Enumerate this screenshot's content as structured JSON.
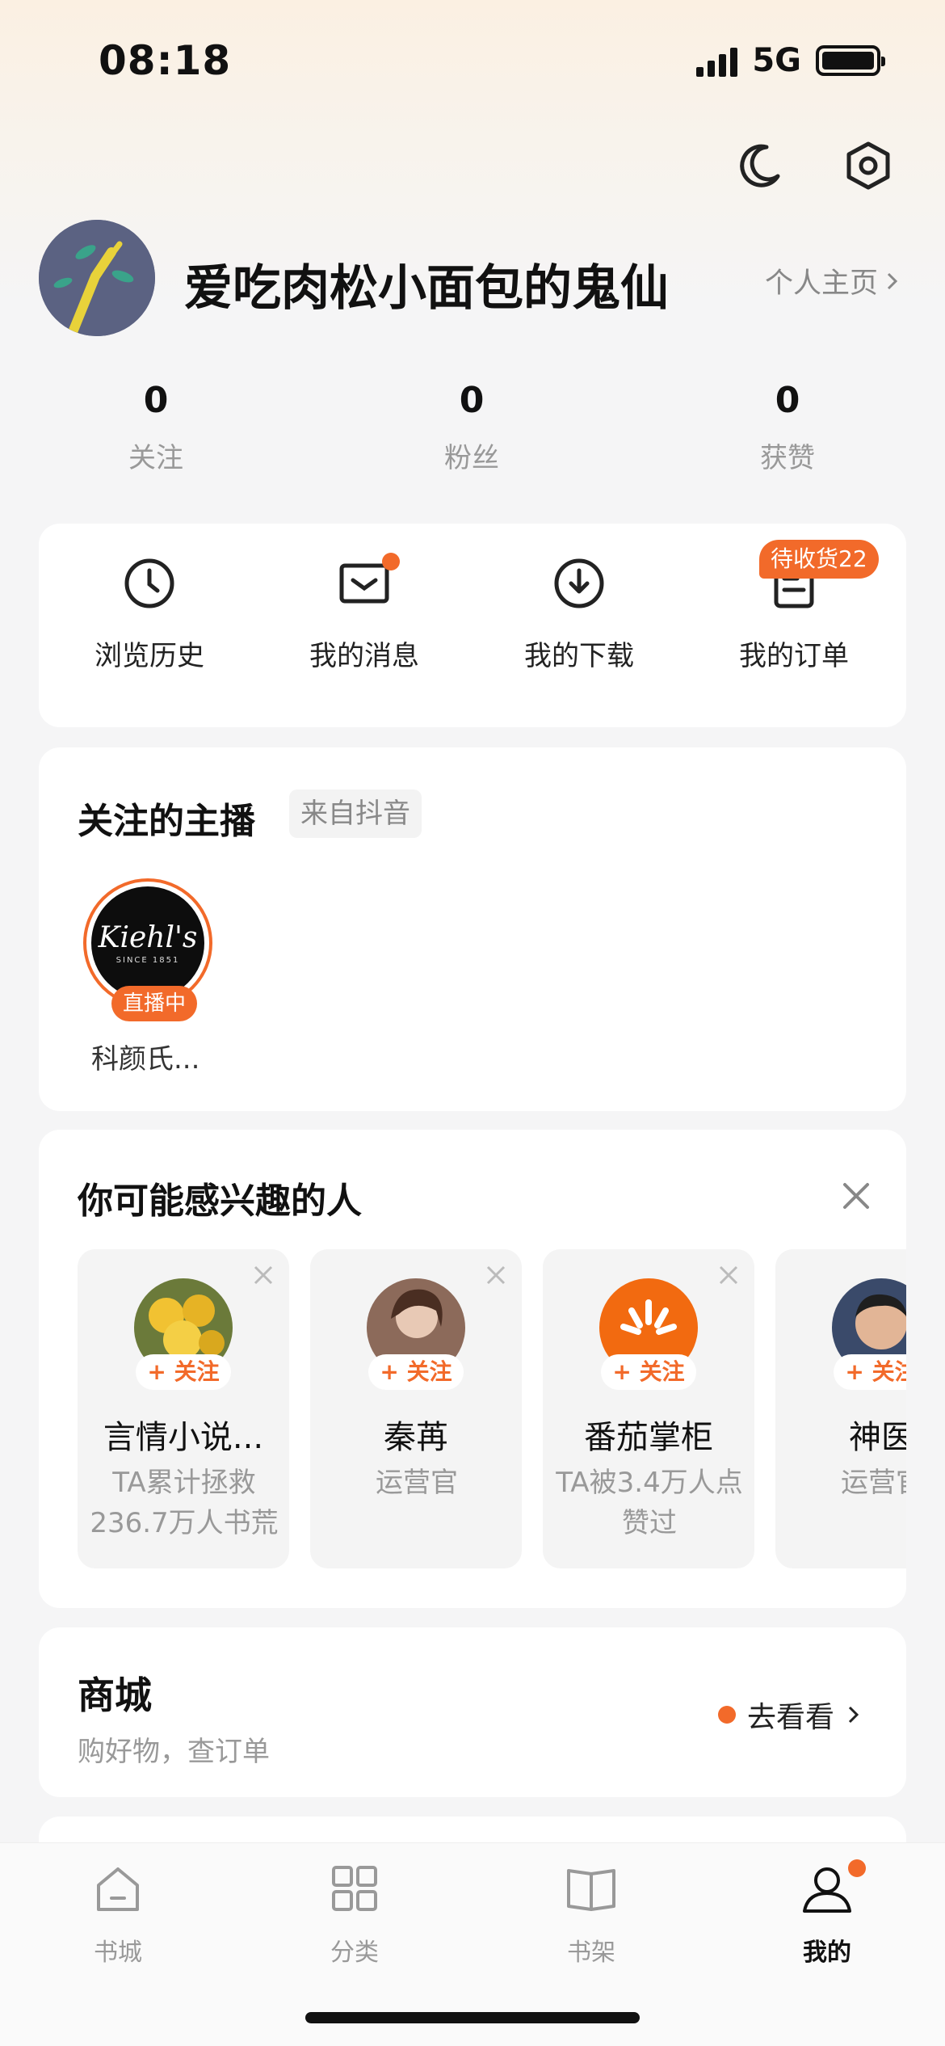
{
  "status_bar": {
    "time": "08:18",
    "network": "5G"
  },
  "header": {
    "icons": [
      "moon-icon",
      "settings-icon"
    ]
  },
  "profile": {
    "username": "爱吃肉松小面包的鬼仙",
    "homepage_link": "个人主页",
    "stats": [
      {
        "value": "0",
        "label": "关注"
      },
      {
        "value": "0",
        "label": "粉丝"
      },
      {
        "value": "0",
        "label": "获赞"
      }
    ]
  },
  "quick_actions": [
    {
      "label": "浏览历史",
      "icon": "clock-icon"
    },
    {
      "label": "我的消息",
      "icon": "message-icon",
      "has_dot": true
    },
    {
      "label": "我的下载",
      "icon": "download-icon"
    },
    {
      "label": "我的订单",
      "icon": "order-icon",
      "badge": "待收货22"
    }
  ],
  "followed_streamers": {
    "title": "关注的主播",
    "source_tag": "来自抖音",
    "items": [
      {
        "name": "科颜氏...",
        "live_badge": "直播中",
        "logo_text": "Kiehl's",
        "logo_sub": "SINCE 1851"
      }
    ]
  },
  "suggested_people": {
    "title": "你可能感兴趣的人",
    "follow_label": "+ 关注",
    "items": [
      {
        "name": "言情小说...",
        "desc": "TA累计拯救236.7万人书荒"
      },
      {
        "name": "秦苒",
        "desc": "运营官"
      },
      {
        "name": "番茄掌柜",
        "desc": "TA被3.4万人点赞过"
      },
      {
        "name": "神医",
        "desc": "运营官"
      }
    ]
  },
  "mall": {
    "title": "商城",
    "subtitle": "购好物，查订单",
    "action": "去看看"
  },
  "tab_bar": {
    "items": [
      {
        "label": "书城",
        "icon": "home-icon"
      },
      {
        "label": "分类",
        "icon": "category-icon"
      },
      {
        "label": "书架",
        "icon": "bookshelf-icon"
      },
      {
        "label": "我的",
        "icon": "profile-icon",
        "active": true,
        "has_dot": true
      }
    ]
  },
  "colors": {
    "accent": "#f26a2a",
    "background": "#f5f5f6"
  }
}
